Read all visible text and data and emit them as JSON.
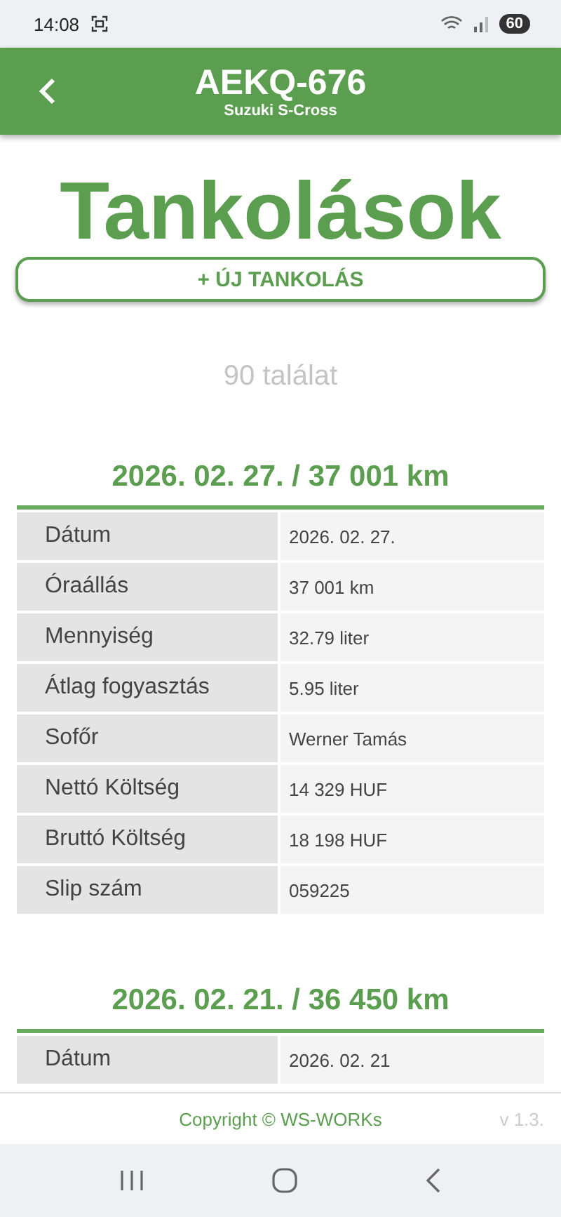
{
  "status_bar": {
    "time": "14:08",
    "battery": "60"
  },
  "app_bar": {
    "title": "AEKQ-676",
    "subtitle": "Suzuki S-Cross"
  },
  "page_title": "Tankolások",
  "new_button": "+ ÚJ TANKOLÁS",
  "result_count": "90 találat",
  "records": [
    {
      "heading": "2026. 02. 27. / 37 001 km",
      "rows": [
        {
          "label": "Dátum",
          "value": "2026. 02. 27."
        },
        {
          "label": "Óraállás",
          "value": "37 001 km"
        },
        {
          "label": "Mennyiség",
          "value": "32.79 liter"
        },
        {
          "label": "Átlag fogyasztás",
          "value": "5.95 liter"
        },
        {
          "label": "Sofőr",
          "value": "Werner Tamás"
        },
        {
          "label": "Nettó Költség",
          "value": "14 329 HUF"
        },
        {
          "label": "Bruttó Költség",
          "value": "18 198 HUF"
        },
        {
          "label": "Slip szám",
          "value": "059225"
        }
      ]
    },
    {
      "heading": "2026. 02. 21. / 36 450 km",
      "rows": [
        {
          "label": "Dátum",
          "value": "2026. 02. 21"
        }
      ]
    }
  ],
  "footer": {
    "copyright": "Copyright © WS-WORKs",
    "version": "v 1.3."
  }
}
